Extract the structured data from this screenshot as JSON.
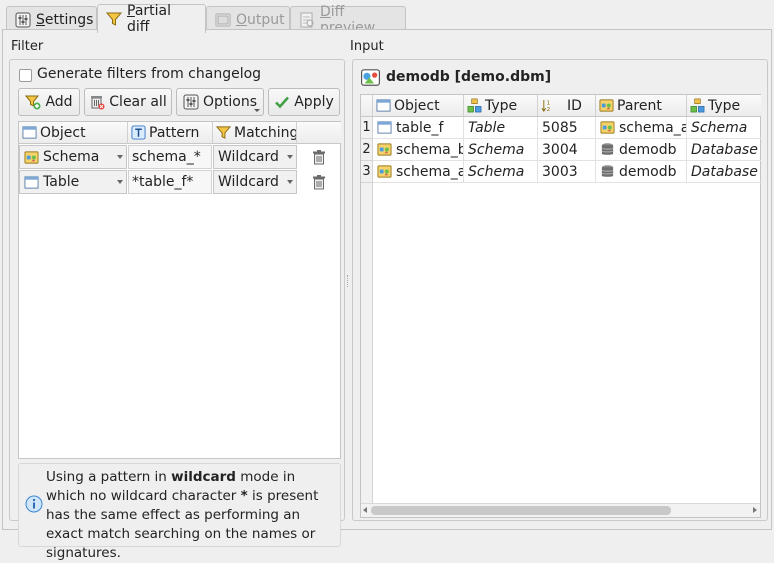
{
  "tabs": [
    {
      "label": "Settings",
      "accel": "S",
      "state": "normal"
    },
    {
      "label": "Partial diff",
      "accel": "P",
      "state": "active"
    },
    {
      "label": "Output",
      "accel": "O",
      "state": "disabled"
    },
    {
      "label": "Diff preview",
      "accel": "D",
      "state": "disabled"
    }
  ],
  "filter": {
    "section_label": "Filter",
    "generate_checkbox": {
      "label": "Generate filters from changelog",
      "checked": false
    },
    "toolbar": {
      "add": "Add",
      "clear_all": "Clear all",
      "options": "Options",
      "apply": "Apply"
    },
    "columns": [
      "Object",
      "Pattern",
      "Matching"
    ],
    "rows": [
      {
        "object": "Schema",
        "object_icon": "schema-icon",
        "pattern": "schema_*",
        "matching": "Wildcard"
      },
      {
        "object": "Table",
        "object_icon": "table-icon",
        "pattern": "*table_f*",
        "matching": "Wildcard"
      }
    ],
    "hint": {
      "part1": "Using a pattern in ",
      "bold1": "wildcard",
      "part2": " mode in which no wildcard character ",
      "bold2": "*",
      "part3": " is present has the same effect as performing an exact match searching on the names or signatures."
    }
  },
  "input": {
    "section_label": "Input",
    "db_label": "demodb [demo.dbm]",
    "columns": [
      "Object",
      "Type",
      "ID",
      "Parent",
      "Type"
    ],
    "rows": [
      {
        "num": "1",
        "object": "table_f",
        "object_icon": "table-icon",
        "type": "Table",
        "id": "5085",
        "parent": "schema_a",
        "parent_icon": "schema-icon",
        "parent_type": "Schema"
      },
      {
        "num": "2",
        "object": "schema_b",
        "object_icon": "schema-icon",
        "type": "Schema",
        "id": "3004",
        "parent": "demodb",
        "parent_icon": "database-icon",
        "parent_type": "Database"
      },
      {
        "num": "3",
        "object": "schema_a",
        "object_icon": "schema-icon",
        "type": "Schema",
        "id": "3003",
        "parent": "demodb",
        "parent_icon": "database-icon",
        "parent_type": "Database"
      }
    ]
  }
}
